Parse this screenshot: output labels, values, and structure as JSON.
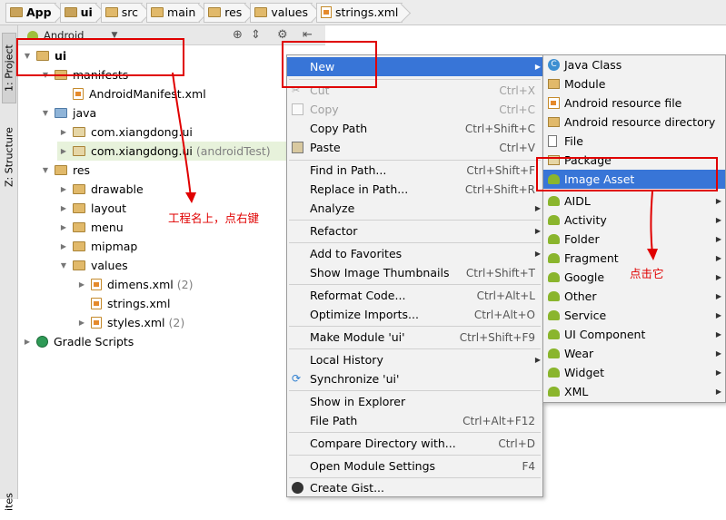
{
  "breadcrumbs": [
    "App",
    "ui",
    "src",
    "main",
    "res",
    "values",
    "strings.xml"
  ],
  "side_tabs": {
    "project": "1: Project",
    "structure": "Z: Structure",
    "favorites": "ites"
  },
  "panel": {
    "view_mode": "Android"
  },
  "tree": [
    {
      "label": "ui",
      "icon": "module-folder-icon",
      "level": 0,
      "state": "expanded",
      "bold": true
    },
    {
      "label": "manifests",
      "icon": "folder-icon",
      "level": 1,
      "state": "expanded"
    },
    {
      "label": "AndroidManifest.xml",
      "icon": "xml-file-icon",
      "level": 2,
      "state": "leaf"
    },
    {
      "label": "java",
      "icon": "java-folder-icon",
      "level": 1,
      "state": "expanded"
    },
    {
      "label": "com.xiangdong.ui",
      "icon": "package-icon",
      "level": 2,
      "state": "collapsed"
    },
    {
      "label": "com.xiangdong.ui",
      "suffix": "(androidTest)",
      "icon": "package-icon",
      "level": 2,
      "state": "collapsed",
      "highlight": true
    },
    {
      "label": "res",
      "icon": "res-folder-icon",
      "level": 1,
      "state": "expanded"
    },
    {
      "label": "drawable",
      "icon": "folder-icon",
      "level": 2,
      "state": "collapsed"
    },
    {
      "label": "layout",
      "icon": "folder-icon",
      "level": 2,
      "state": "collapsed"
    },
    {
      "label": "menu",
      "icon": "folder-icon",
      "level": 2,
      "state": "collapsed"
    },
    {
      "label": "mipmap",
      "icon": "folder-icon",
      "level": 2,
      "state": "collapsed"
    },
    {
      "label": "values",
      "icon": "folder-icon",
      "level": 2,
      "state": "expanded"
    },
    {
      "label": "dimens.xml",
      "suffix": "(2)",
      "icon": "xml-file-icon",
      "level": 3,
      "state": "collapsed"
    },
    {
      "label": "strings.xml",
      "icon": "xml-file-icon",
      "level": 3,
      "state": "leaf"
    },
    {
      "label": "styles.xml",
      "suffix": "(2)",
      "icon": "xml-file-icon",
      "level": 3,
      "state": "collapsed"
    },
    {
      "label": "Gradle Scripts",
      "icon": "gradle-icon",
      "level": 0,
      "state": "collapsed"
    }
  ],
  "context_menu": [
    {
      "label": "New",
      "shortcut": "",
      "submenu": true,
      "active": true
    },
    {
      "separator": true
    },
    {
      "label": "Cut",
      "shortcut": "Ctrl+X",
      "disabled": true,
      "icon": "cut-icon"
    },
    {
      "label": "Copy",
      "shortcut": "Ctrl+C",
      "disabled": true,
      "icon": "copy-icon"
    },
    {
      "label": "Copy Path",
      "shortcut": "Ctrl+Shift+C"
    },
    {
      "label": "Paste",
      "shortcut": "Ctrl+V",
      "icon": "paste-icon"
    },
    {
      "separator": true
    },
    {
      "label": "Find in Path...",
      "shortcut": "Ctrl+Shift+F"
    },
    {
      "label": "Replace in Path...",
      "shortcut": "Ctrl+Shift+R"
    },
    {
      "label": "Analyze",
      "shortcut": "",
      "submenu": true
    },
    {
      "separator": true
    },
    {
      "label": "Refactor",
      "shortcut": "",
      "submenu": true
    },
    {
      "separator": true
    },
    {
      "label": "Add to Favorites",
      "shortcut": "",
      "submenu": true
    },
    {
      "label": "Show Image Thumbnails",
      "shortcut": "Ctrl+Shift+T"
    },
    {
      "separator": true
    },
    {
      "label": "Reformat Code...",
      "shortcut": "Ctrl+Alt+L"
    },
    {
      "label": "Optimize Imports...",
      "shortcut": "Ctrl+Alt+O"
    },
    {
      "separator": true
    },
    {
      "label": "Make Module 'ui'",
      "shortcut": "Ctrl+Shift+F9"
    },
    {
      "separator": true
    },
    {
      "label": "Local History",
      "shortcut": "",
      "submenu": true
    },
    {
      "label": "Synchronize 'ui'",
      "shortcut": "",
      "icon": "sync-icon"
    },
    {
      "separator": true
    },
    {
      "label": "Show in Explorer",
      "shortcut": ""
    },
    {
      "label": "File Path",
      "shortcut": "Ctrl+Alt+F12"
    },
    {
      "separator": true
    },
    {
      "label": "Compare Directory with...",
      "shortcut": "Ctrl+D"
    },
    {
      "separator": true
    },
    {
      "label": "Open Module Settings",
      "shortcut": "F4"
    },
    {
      "separator": true
    },
    {
      "label": "Create Gist...",
      "shortcut": "",
      "icon": "github-icon"
    }
  ],
  "submenu": [
    {
      "label": "Java Class",
      "icon": "java-class-icon"
    },
    {
      "label": "Module",
      "icon": "module-icon"
    },
    {
      "label": "Android resource file",
      "icon": "resource-file-icon"
    },
    {
      "label": "Android resource directory",
      "icon": "resource-folder-icon"
    },
    {
      "label": "File",
      "icon": "file-icon"
    },
    {
      "label": "Package",
      "icon": "package-icon"
    },
    {
      "label": "Image Asset",
      "icon": "android-icon",
      "active": true
    },
    {
      "label": "AIDL",
      "icon": "android-icon",
      "submenu": true
    },
    {
      "label": "Activity",
      "icon": "android-icon",
      "submenu": true
    },
    {
      "label": "Folder",
      "icon": "android-icon",
      "submenu": true
    },
    {
      "label": "Fragment",
      "icon": "android-icon",
      "submenu": true
    },
    {
      "label": "Google",
      "icon": "android-icon",
      "submenu": true
    },
    {
      "label": "Other",
      "icon": "android-icon",
      "submenu": true
    },
    {
      "label": "Service",
      "icon": "android-icon",
      "submenu": true
    },
    {
      "label": "UI Component",
      "icon": "android-icon",
      "submenu": true
    },
    {
      "label": "Wear",
      "icon": "android-icon",
      "submenu": true
    },
    {
      "label": "Widget",
      "icon": "android-icon",
      "submenu": true
    },
    {
      "label": "XML",
      "icon": "android-icon",
      "submenu": true
    }
  ],
  "annotations": {
    "right_click_note": "工程名上，点右键",
    "click_it_note": "点击它",
    "color": "#e00000"
  },
  "colors": {
    "menu_highlight": "#3875d7",
    "menu_bg": "#f2f2f2",
    "selection_row": "#e7f2db"
  }
}
